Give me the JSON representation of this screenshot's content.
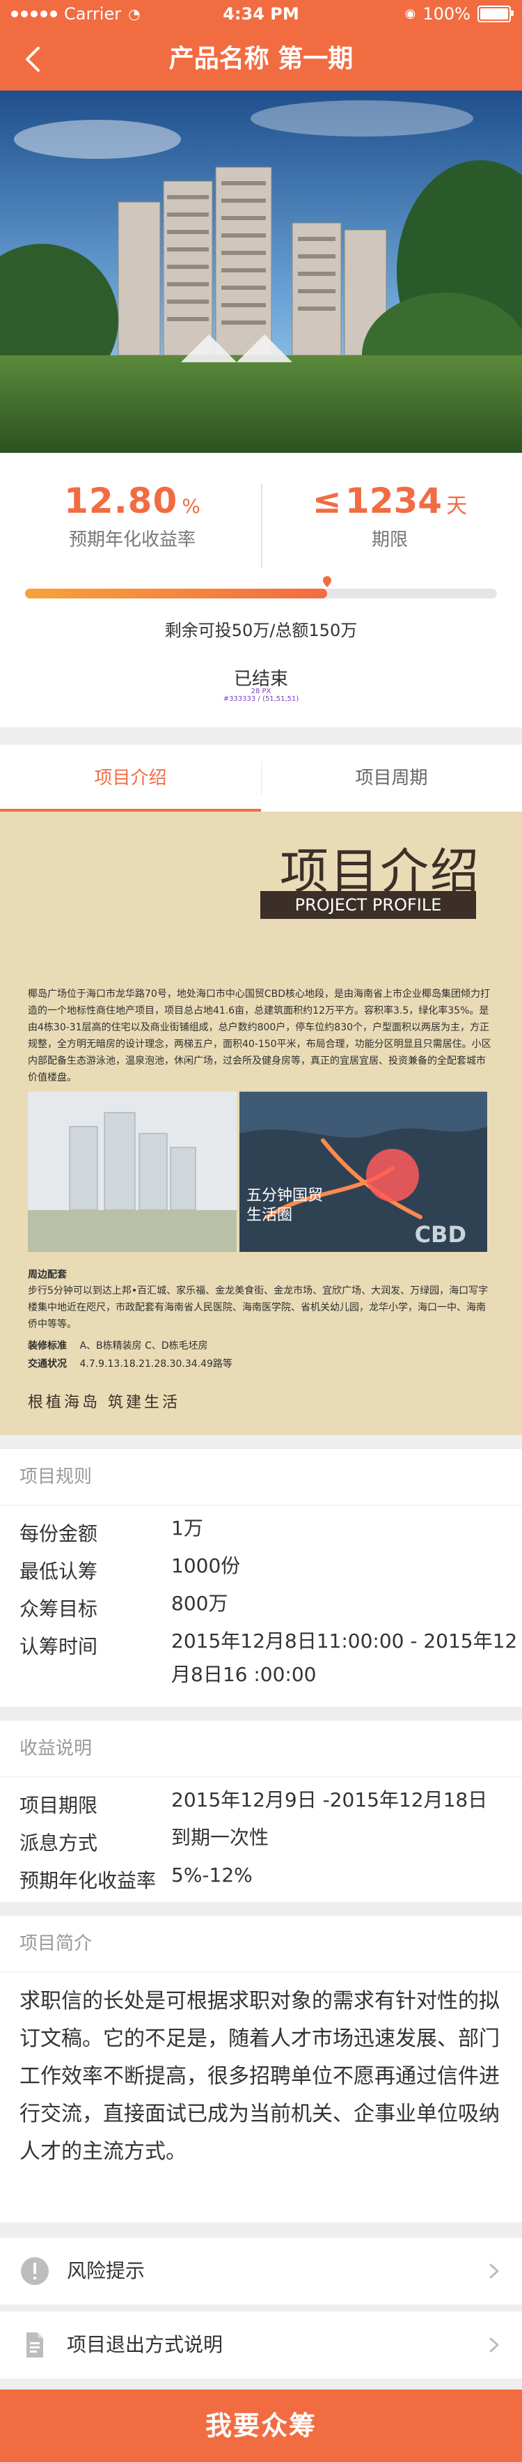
{
  "status_bar": {
    "carrier": "Carrier",
    "time": "4:34 PM",
    "battery": "100%"
  },
  "nav": {
    "title": "产品名称 第一期",
    "back_icon": "chevron-left-icon"
  },
  "summary": {
    "rate_value": "12.80",
    "rate_unit": "%",
    "rate_label": "预期年化收益率",
    "period_prefix": "≤",
    "period_value": "1234",
    "period_unit": "天",
    "period_label": "期限",
    "progress": 0.64,
    "remain_text": "剩余可投50万/总额150万",
    "status_text": "已结束",
    "overlay_label_1": "28 PX",
    "overlay_label_2": "#333333 / (51,51,51)"
  },
  "tabs": [
    {
      "label": "项目介绍",
      "active": true
    },
    {
      "label": "项目周期",
      "active": false
    }
  ],
  "poster": {
    "heading_cn": "项目介绍",
    "heading_en": "PROJECT PROFILE",
    "intro": "椰岛广场位于海口市龙华路70号，地处海口市中心国贸CBD核心地段，是由海南省上市企业椰岛集团倾力打造的一个地标性商住地产项目，项目总占地41.6亩，总建筑面积约12万平方。容积率3.5，绿化率35%。是由4栋30-31层高的住宅以及商业街铺组成，总户数约800户，停车位约830个，户型面积以两居为主，方正规整，全方明无暗房的设计理念，两梯五户，面积40-150平米，布局合理，功能分区明显且只需居住。小区内部配备生态游泳池，温泉泡池，休闲广场，过会所及健身房等，真正的宜居宜居、投资兼备的全配套城市价值楼盘。",
    "map_caption_1": "五分钟国贸",
    "map_caption_2": "生活圈",
    "cbd_mark": "CBD",
    "surround_title": "周边配套",
    "surround_text": "步行5分钟可以到达上邦•百汇城、家乐福、金龙美食街、金龙市场、宜欣广场、大润发、万绿园，海口写字楼集中地近在咫尺，市政配套有海南省人民医院、海南医学院、省机关幼儿园，龙华小学，海口一中、海南侨中等等。",
    "kv": [
      {
        "k": "装修标准",
        "v": "A、B栋精装房      C、D栋毛坯房"
      },
      {
        "k": "交通状况",
        "v": "4.7.9.13.18.21.28.30.34.49路等"
      }
    ],
    "slogan": "根植海岛  筑建生活"
  },
  "rules": {
    "title": "项目规则",
    "rows": [
      {
        "k": "每份金额",
        "v": "1万"
      },
      {
        "k": "最低认筹",
        "v": "1000份"
      },
      {
        "k": "众筹目标",
        "v": "800万"
      },
      {
        "k": "认筹时间",
        "v": "2015年12月8日11:00:00 - 2015年12月8日16 :00:00"
      }
    ]
  },
  "income": {
    "title": "收益说明",
    "rows": [
      {
        "k": "项目期限",
        "v": "2015年12月9日 -2015年12月18日"
      },
      {
        "k": "派息方式",
        "v": "到期一次性"
      },
      {
        "k": "预期年化收益率",
        "v": "5%-12%"
      }
    ]
  },
  "intro": {
    "title": "项目简介",
    "text": "求职信的长处是可根据求职对象的需求有针对性的拟订文稿。它的不足是，随着人才市场迅速发展、部门工作效率不断提高，很多招聘单位不愿再通过信件进行交流，直接面试已成为当前机关、企事业单位吸纳人才的主流方式。"
  },
  "list": [
    {
      "label": "风险提示",
      "icon": "alert-icon"
    },
    {
      "label": "项目退出方式说明",
      "icon": "document-icon"
    }
  ],
  "cta": {
    "label": "我要众筹"
  },
  "colors": {
    "accent": "#f26c41",
    "accent2": "#f7a23b",
    "poster_bg": "#e9dbb6"
  }
}
